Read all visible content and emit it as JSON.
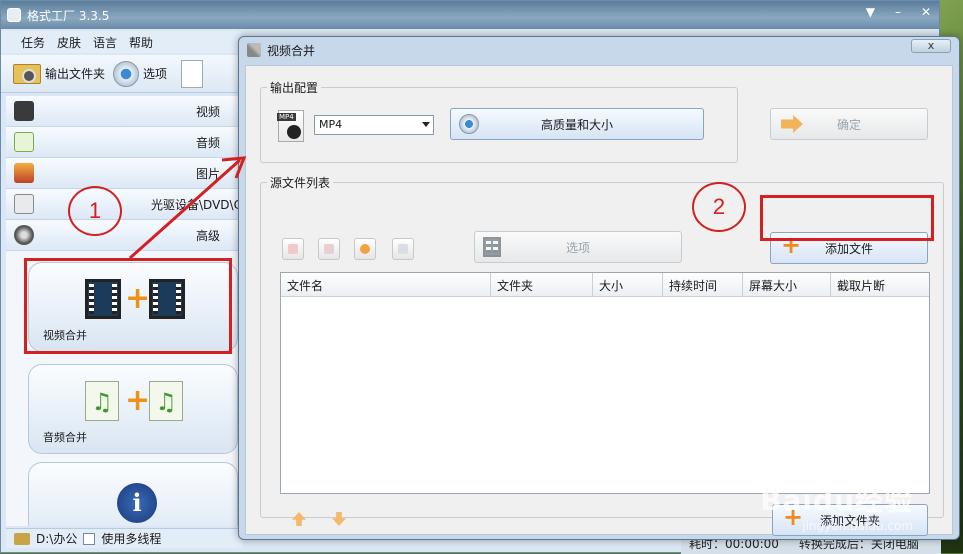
{
  "app": {
    "title": "格式工厂 3.3.5"
  },
  "menu": [
    "任务",
    "皮肤",
    "语言",
    "帮助"
  ],
  "toolbar": {
    "output_folder": "输出文件夹",
    "options": "选项"
  },
  "sidebar": {
    "categories": [
      {
        "label": "视频",
        "icon": "video-icon"
      },
      {
        "label": "音频",
        "icon": "audio-icon"
      },
      {
        "label": "图片",
        "icon": "image-icon"
      },
      {
        "label": "光驱设备\\DVD\\CD",
        "icon": "disc-icon"
      },
      {
        "label": "高级",
        "icon": "advanced-icon"
      }
    ],
    "tiles": [
      {
        "label": "视频合并"
      },
      {
        "label": "音频合并"
      }
    ]
  },
  "status": {
    "path": "D:\\办公",
    "multithread": "使用多线程"
  },
  "main_status": {
    "elapsed": "耗时：00:00:00",
    "after": "转换完成后：关闭电脑"
  },
  "dialog": {
    "title": "视频合并",
    "close_label": "x",
    "output_group": "输出配置",
    "format_icon_tag": "MP4",
    "format_value": "MP4",
    "quality_button": "高质量和大小",
    "ok_button": "确定",
    "source_group": "源文件列表",
    "options_button": "选项",
    "add_file_button": "添加文件",
    "add_file_button_2": "添加文件夹",
    "columns": [
      "文件名",
      "文件夹",
      "大小",
      "持续时间",
      "屏幕大小",
      "截取片断"
    ]
  },
  "annotations": {
    "one": "1",
    "two": "2"
  },
  "watermark": {
    "brand": "Baidu经验",
    "url": "jingyan.baidu.com"
  },
  "colors": {
    "annotation_red": "#d42020",
    "accent_orange": "#f08a18"
  }
}
